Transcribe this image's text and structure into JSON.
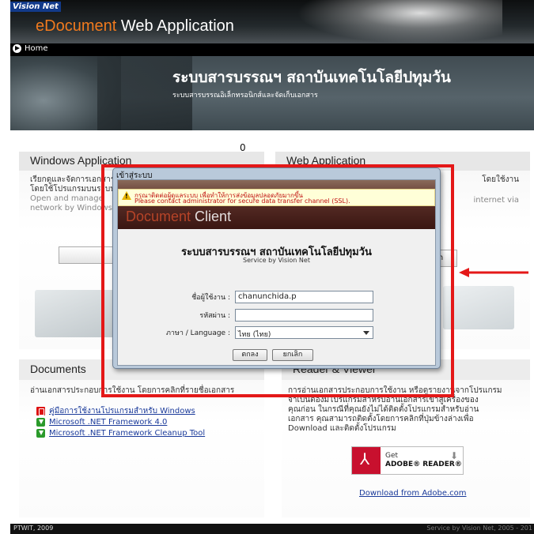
{
  "header": {
    "logo": "Vision Net",
    "title_accent": "eDocument",
    "title_rest": " Web Application",
    "home_label": "Home",
    "institute_title": "ระบบสารบรรณฯ สถาบันเทคโนโลยีปทุมวัน",
    "institute_subtitle": "ระบบสารบรรณอิเล็กทรอนิกส์และจัดเก็บเอกสาร"
  },
  "overlay_label": "0",
  "windows_app": {
    "title": "Windows Application",
    "thai_text_1": "เรียกดูและจัดการเอกสาร",
    "thai_text_2": "โดยใช้โปรแกรมบนระบบ",
    "en_text_1": "Open and manage",
    "en_text_2": "network by Windows"
  },
  "web_app": {
    "title": "Web Application",
    "thai_text": "โดยใช้งาน",
    "en_text": "internet via",
    "button_partial": "ion"
  },
  "documents": {
    "title": "Documents",
    "description": "อ่านเอกสารประกอบการใช้งาน โดยการคลิกที่รายชื่อเอกสาร",
    "links": [
      {
        "icon": "pdf-icon",
        "label": "คู่มือการใช้งานโปรแกรมสำหรับ Windows"
      },
      {
        "icon": "download-icon",
        "label": "Microsoft .NET Framework 4.0"
      },
      {
        "icon": "download-icon",
        "label": "Microsoft .NET Framework Cleanup Tool"
      }
    ]
  },
  "reader": {
    "title": "Reader & Viewer",
    "line1": "การอ่านเอกสารประกอบการใช้งาน หรือดูรายงานจากโปรแกรม",
    "line2": "จำเป็นต้องมีโปรแกรมสำหรับอ่านเอกสารเข้าสู่เครื่องของ",
    "line3": "คุณก่อน ในกรณีที่คุณยังไม่ได้ติดตั้งโปรแกรมสำหรับอ่าน",
    "line4": "เอกสาร คุณสามารถติดตั้งโดยการคลิกที่ปุ่มข้างล่างเพื่อ",
    "line5": "Download และติดตั้งโปรแกรม",
    "badge_get": "Get",
    "badge_name": "ADOBE® READER®",
    "download_link": "Download from Adobe.com"
  },
  "footer": {
    "left": "PTWIT, 2009",
    "right": "Service by Vision Net, 2005 - 201"
  },
  "dialog": {
    "title": "เข้าสู่ระบบ",
    "warning_thai": "กรุณาติดต่อผู้ดูแลระบบ เพื่อทำให้การส่งข้อมูลปลอดภัยมากขึ้น",
    "warning_en": "Please contact administrator for secure data transfer channel (SSL).",
    "brand_a": "Document",
    "brand_b": " Client",
    "form_title": "ระบบสารบรรณฯ สถาบันเทคโนโลยีปทุมวัน",
    "form_subtitle": "Service by Vision Net",
    "username_label": "ชื่อผู้ใช้งาน :",
    "username_value": "chanunchida.p",
    "password_label": "รหัสผ่าน :",
    "password_value": "",
    "language_label": "ภาษา / Language :",
    "language_value": "ไทย (ไทย)",
    "ok_label": "ตกลง",
    "cancel_label": "ยกเลิก"
  },
  "colors": {
    "highlight": "#e41818",
    "link": "#1a3a9a",
    "accent": "#f07a1e"
  }
}
